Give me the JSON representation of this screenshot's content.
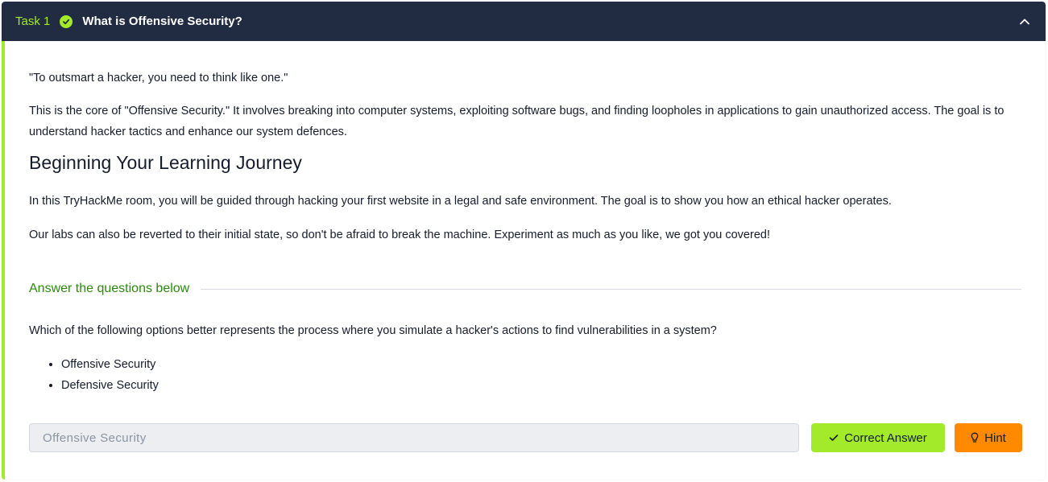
{
  "task": {
    "label": "Task 1",
    "title": "What is Offensive Security?",
    "completed": true,
    "collapse_icon": "chevron-up-icon"
  },
  "content": {
    "quote": "\"To outsmart a hacker, you need to think like one.\"",
    "intro": "This is the core of \"Offensive Security.\" It involves breaking into computer systems, exploiting software bugs, and finding loopholes in applications to gain unauthorized access. The goal is to understand hacker tactics and enhance our system defences.",
    "journey_heading": "Beginning Your Learning Journey",
    "journey_text": "In this TryHackMe room, you will be guided through hacking your first website in a legal and safe environment. The goal is to show you how an ethical hacker operates.",
    "labs_text": "Our labs can also be reverted to their initial state, so don't be afraid to break the machine. Experiment as much as you like, we got you covered!"
  },
  "questions": {
    "heading": "Answer the questions below",
    "question_text": "Which of the following options better represents the process where you simulate a hacker's actions to find vulnerabilities in a system?",
    "options": [
      "Offensive Security",
      "Defensive Security"
    ],
    "answer_value": "Offensive Security",
    "correct_label": "Correct Answer",
    "hint_label": "Hint"
  },
  "colors": {
    "header_bg": "#212c42",
    "accent_green": "#a3ea2a",
    "heading_green": "#2a8a0d",
    "hint_orange": "#ff8a00"
  }
}
